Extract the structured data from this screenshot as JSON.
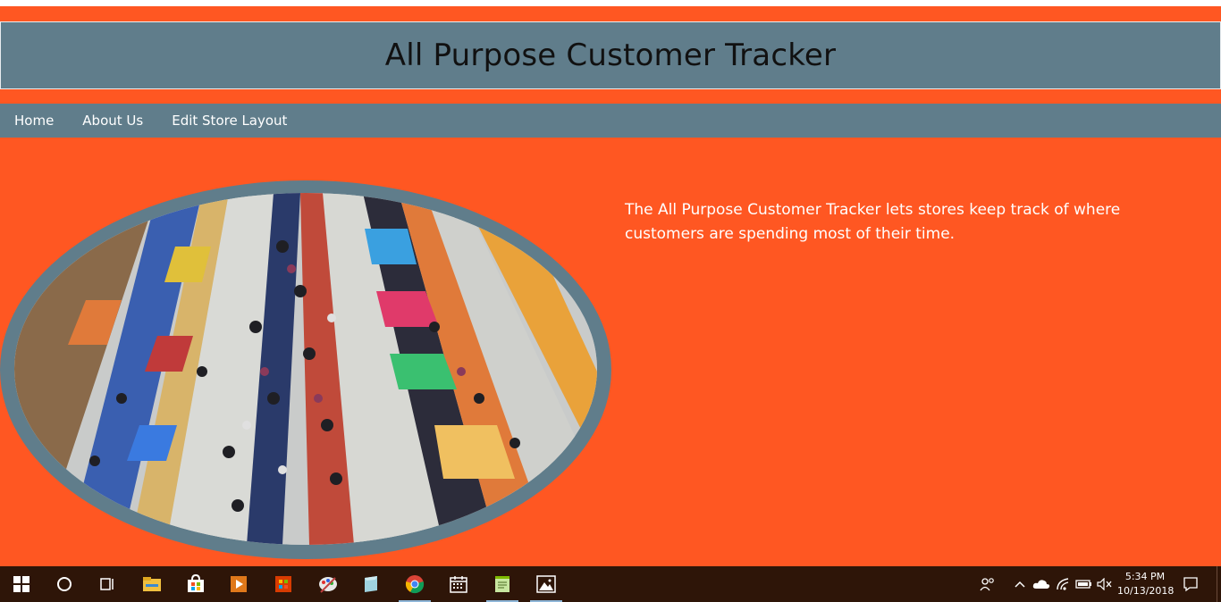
{
  "header": {
    "title": "All Purpose Customer Tracker"
  },
  "nav": {
    "items": [
      {
        "label": "Home"
      },
      {
        "label": "About Us"
      },
      {
        "label": "Edit Store Layout"
      }
    ]
  },
  "main": {
    "intro": "The All Purpose Customer Tracker lets stores keep track of where customers are spending most of their time."
  },
  "colors": {
    "page_background": "#ff5722",
    "header_background": "#607d8b",
    "nav_background": "#607d8b",
    "taskbar_background": "#2e1508"
  },
  "taskbar": {
    "apps": [
      {
        "icon": "windows-start-icon"
      },
      {
        "icon": "cortana-search-icon"
      },
      {
        "icon": "task-view-icon"
      },
      {
        "icon": "file-explorer-icon"
      },
      {
        "icon": "store-icon"
      },
      {
        "icon": "media-player-icon"
      },
      {
        "icon": "office-icon"
      },
      {
        "icon": "paint-icon"
      },
      {
        "icon": "notes-icon"
      },
      {
        "icon": "chrome-icon"
      },
      {
        "icon": "calendar-icon"
      },
      {
        "icon": "notepad-icon"
      },
      {
        "icon": "photos-icon"
      }
    ],
    "tray_icons": [
      "people-icon",
      "chevron-up-icon",
      "onedrive-icon",
      "wifi-icon",
      "battery-icon",
      "volume-muted-icon",
      "action-center-icon"
    ],
    "time": "5:34 PM",
    "date": "10/13/2018"
  }
}
